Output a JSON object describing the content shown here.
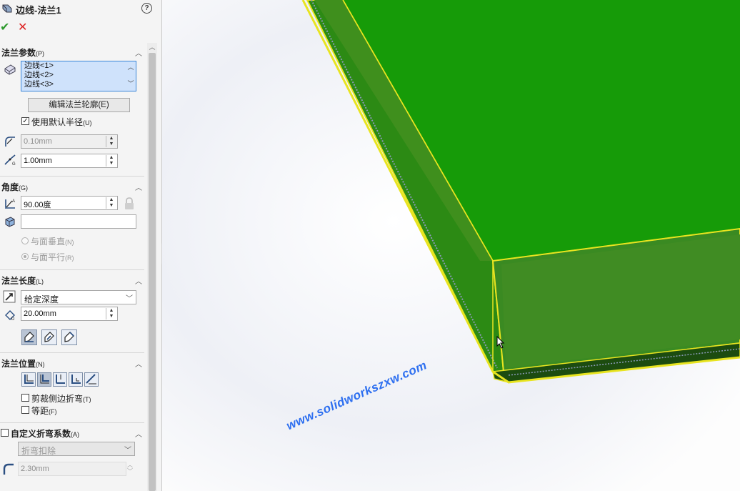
{
  "header": {
    "title": "边线-法兰1",
    "help_icon": "?",
    "ok_icon": "✔",
    "cancel_icon": "✕"
  },
  "flange_params": {
    "title": "法兰参数",
    "title_key": "(P)",
    "edges": [
      "边线<1>",
      "边线<2>",
      "边线<3>"
    ],
    "edit_profile_button": "编辑法兰轮廓(E)",
    "use_default_radius": {
      "label": "使用默认半径",
      "key": "(U)",
      "checked": true
    },
    "bend_radius": "0.10mm",
    "gap_distance": "1.00mm"
  },
  "angle": {
    "title": "角度",
    "title_key": "(G)",
    "angle_value": "90.00度",
    "reference_face": "",
    "perpendicular": {
      "label": "与面垂直",
      "key": "(N)"
    },
    "parallel": {
      "label": "与面平行",
      "key": "(R)"
    }
  },
  "flange_length": {
    "title": "法兰长度",
    "title_key": "(L)",
    "end_condition": "给定深度",
    "length": "20.00mm"
  },
  "flange_position": {
    "title": "法兰位置",
    "title_key": "(N)",
    "trim_side_bends": {
      "label": "剪裁侧边折弯",
      "key": "(T)"
    },
    "offset": {
      "label": "等距",
      "key": "(F)"
    }
  },
  "custom_bend": {
    "title": "自定义折弯系数",
    "title_key": "(A)",
    "type": "折弯扣除",
    "value": "2.30mm"
  },
  "watermark": "www.solidworkszxw.com",
  "colors": {
    "flange_green": "#1e9a0c",
    "edge_yellow": "#e8e420",
    "list_highlight": "#cfe2fb"
  }
}
